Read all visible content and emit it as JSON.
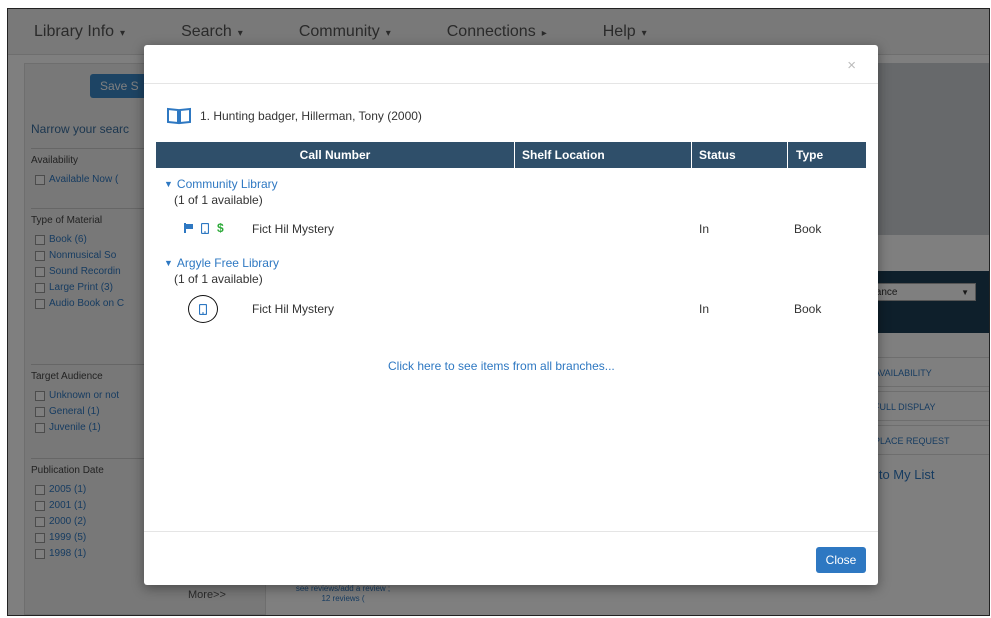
{
  "nav": {
    "items": [
      "Library Info",
      "Search",
      "Community",
      "Connections",
      "Help"
    ]
  },
  "sidebar": {
    "save_label": "Save S",
    "narrow_label": "Narrow your searc",
    "availability": {
      "title": "Availability",
      "options": [
        "Available Now ("
      ]
    },
    "material": {
      "title": "Type of Material",
      "options": [
        "Book (6)",
        "Nonmusical So",
        "Sound Recordin",
        "Large Print (3)",
        "Audio Book on C"
      ]
    },
    "audience": {
      "title": "Target Audience",
      "options": [
        "Unknown or not",
        "General (1)",
        "Juvenile (1)"
      ]
    },
    "pubdate": {
      "title": "Publication Date",
      "options": [
        "2005 (1)",
        "2001 (1)",
        "2000 (2)",
        "1999 (5)",
        "1998 (1)"
      ]
    },
    "more_label": "More>>"
  },
  "background": {
    "relevance_label": "levance",
    "actions": [
      "AVAILABILITY",
      "FULL DISPLAY",
      "PLACE REQUEST"
    ],
    "add_list": "d to My List",
    "reviews_text": "see reviews/add a review ; 12 reviews ("
  },
  "modal": {
    "close_x": "×",
    "record_title": "1. Hunting badger, Hillerman, Tony (2000)",
    "columns": [
      "Call Number",
      "Shelf Location",
      "Status",
      "Type"
    ],
    "libraries": [
      {
        "name": "Community Library",
        "availability": "(1 of 1 available)",
        "call_number": "Fict Hil Mystery",
        "status": "In",
        "type": "Book"
      },
      {
        "name": "Argyle Free Library",
        "availability": "(1 of 1 available)",
        "call_number": "Fict Hil Mystery",
        "status": "In",
        "type": "Book"
      }
    ],
    "icon_dollar": "$",
    "all_branches_link": "Click here to see items from all branches...",
    "close_button": "Close"
  },
  "colors": {
    "accent": "#2e78c2",
    "table_header": "#2f4f6a",
    "dollar": "#2eaa3a"
  }
}
